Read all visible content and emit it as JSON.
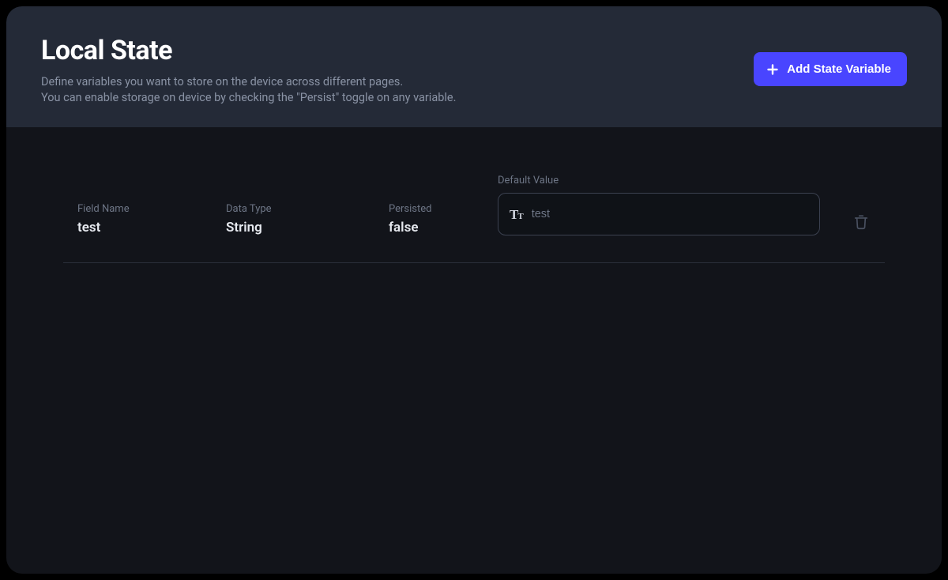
{
  "header": {
    "title": "Local State",
    "subtitle_line1": "Define variables you want to store on the device across different pages.",
    "subtitle_line2": "You can enable storage on device by checking the \"Persist\" toggle on any variable.",
    "add_button_label": "Add State Variable"
  },
  "columns": {
    "field_name": "Field Name",
    "data_type": "Data Type",
    "persisted": "Persisted",
    "default_value": "Default Value"
  },
  "rows": [
    {
      "field_name": "test",
      "data_type": "String",
      "persisted": "false",
      "default_value": "test"
    }
  ]
}
